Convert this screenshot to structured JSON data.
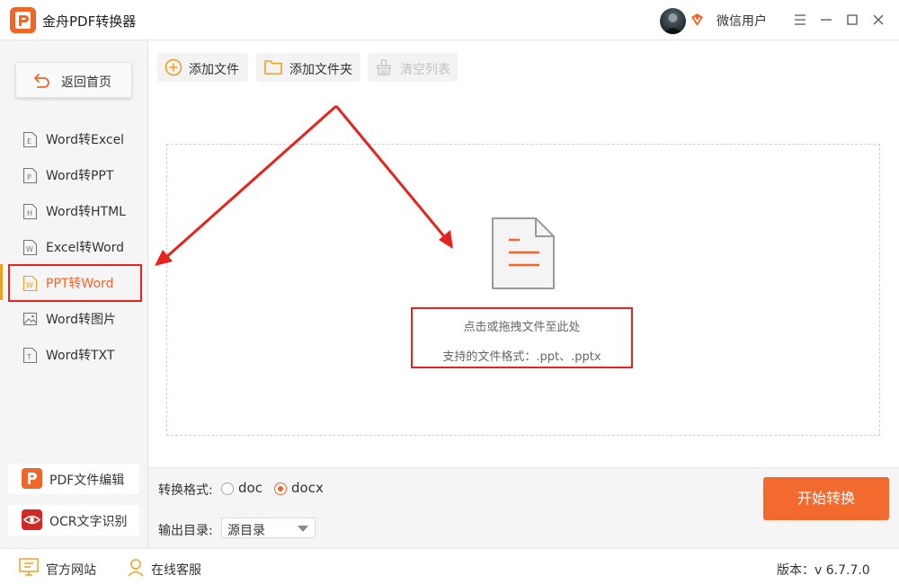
{
  "app": {
    "title": "金舟PDF转换器"
  },
  "user": {
    "name": "微信用户"
  },
  "sidebar": {
    "home_label": "返回首页",
    "items": [
      {
        "label": "Word转Excel",
        "icon": "E"
      },
      {
        "label": "Word转PPT",
        "icon": "P"
      },
      {
        "label": "Word转HTML",
        "icon": "H"
      },
      {
        "label": "Excel转Word",
        "icon": "W"
      },
      {
        "label": "PPT转Word",
        "icon": "W",
        "active": true
      },
      {
        "label": "Word转图片",
        "icon": "image"
      },
      {
        "label": "Word转TXT",
        "icon": "T"
      }
    ],
    "tools": [
      {
        "label": "PDF文件编辑"
      },
      {
        "label": "OCR文字识别"
      }
    ]
  },
  "toolbar": {
    "add_file": "添加文件",
    "add_folder": "添加文件夹",
    "clear_list": "清空列表"
  },
  "dropzone": {
    "hint": "点击或拖拽文件至此处",
    "formats": "支持的文件格式：.ppt、.pptx"
  },
  "settings": {
    "format_label": "转换格式:",
    "format_options": [
      "doc",
      "docx"
    ],
    "format_selected": "docx",
    "output_label": "输出目录:",
    "output_value": "源目录",
    "start_label": "开始转换"
  },
  "statusbar": {
    "website": "官方网站",
    "support": "在线客服",
    "version": "版本：v 6.7.7.0"
  },
  "colors": {
    "accent": "#f26a2e",
    "highlight": "#e8231d"
  }
}
